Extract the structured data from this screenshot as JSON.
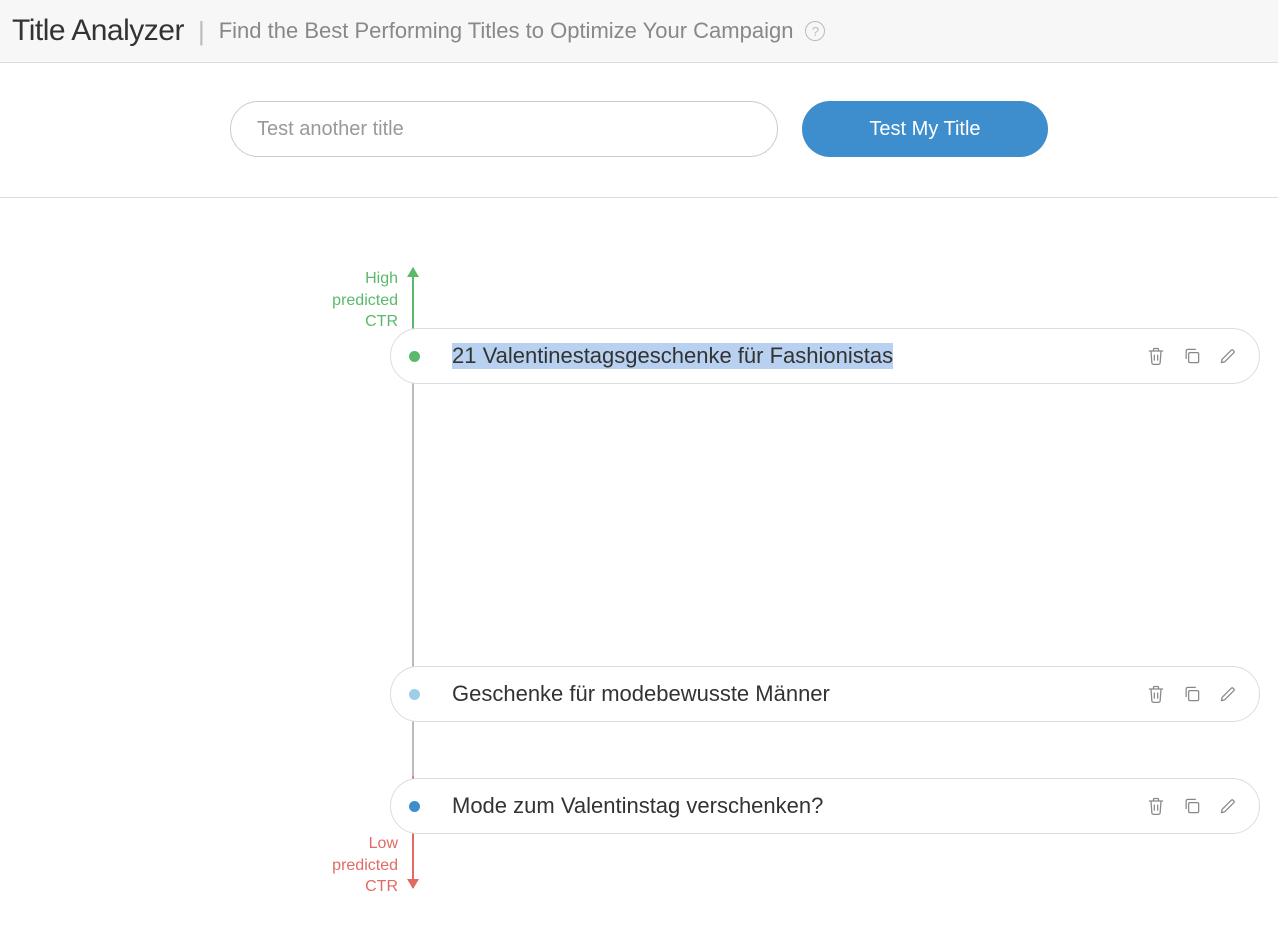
{
  "header": {
    "title": "Title Analyzer",
    "subtitle": "Find the Best Performing Titles to Optimize Your Campaign"
  },
  "search": {
    "placeholder": "Test another title",
    "button_label": "Test My Title"
  },
  "axis": {
    "high_label": "High\npredicted\nCTR",
    "low_label": "Low\npredicted\nCTR"
  },
  "rows": [
    {
      "text": "21 Valentinestagsgeschenke für Fashionistas",
      "dot_color": "#5ab96a",
      "highlighted": true,
      "top": 70
    },
    {
      "text": "Geschenke für modebewusste Männer",
      "dot_color": "#9ecde8",
      "highlighted": false,
      "top": 408
    },
    {
      "text": "Mode zum Valentinstag verschenken?",
      "dot_color": "#3e8ece",
      "highlighted": false,
      "top": 520
    }
  ],
  "colors": {
    "green": "#5ab96a",
    "red": "#e26a64",
    "blue": "#3e8ece"
  },
  "chart_data": {
    "type": "scatter",
    "title": "Predicted CTR ranking",
    "ylabel": "Predicted CTR",
    "ylim": [
      0,
      1
    ],
    "series": [
      {
        "name": "titles",
        "points": [
          {
            "label": "21 Valentinestagsgeschenke für Fashionistas",
            "y": 0.9
          },
          {
            "label": "Geschenke für modebewusste Männer",
            "y": 0.35
          },
          {
            "label": "Mode zum Valentinstag verschenken?",
            "y": 0.17
          }
        ]
      }
    ]
  }
}
